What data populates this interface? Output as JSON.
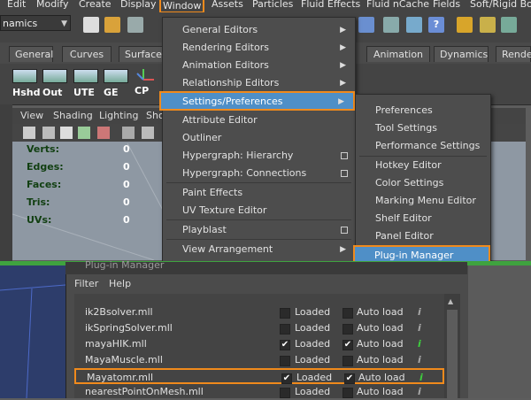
{
  "menubar": {
    "items": [
      "Edit",
      "Modify",
      "Create",
      "Display",
      "Window",
      "Assets",
      "Particles",
      "Fluid Effects",
      "Fluid nCache",
      "Fields",
      "Soft/Rigid Bod"
    ]
  },
  "toolbar": {
    "mode_combo": "namics"
  },
  "shelf": {
    "tabs": [
      "General",
      "Curves",
      "Surfaces",
      "Animation",
      "Dynamics",
      "Rende"
    ],
    "buttons": [
      "Hshd",
      "Out",
      "UTE",
      "GE",
      "CP"
    ]
  },
  "viewport": {
    "menu": [
      "View",
      "Shading",
      "Lighting",
      "Sho"
    ],
    "stats": [
      {
        "label": "Verts:",
        "value": "0"
      },
      {
        "label": "Edges:",
        "value": "0"
      },
      {
        "label": "Faces:",
        "value": "0"
      },
      {
        "label": "Tris:",
        "value": "0"
      },
      {
        "label": "UVs:",
        "value": "0"
      }
    ]
  },
  "window_menu": {
    "items": [
      {
        "label": "General Editors",
        "submenu": true
      },
      {
        "label": "Rendering Editors",
        "submenu": true
      },
      {
        "label": "Animation Editors",
        "submenu": true
      },
      {
        "label": "Relationship Editors",
        "submenu": true
      },
      {
        "label": "Settings/Preferences",
        "submenu": true
      },
      {
        "label": "Attribute Editor"
      },
      {
        "label": "Outliner"
      },
      {
        "label": "Hypergraph: Hierarchy",
        "option": true
      },
      {
        "label": "Hypergraph: Connections",
        "option": true
      },
      {
        "label": "Paint Effects"
      },
      {
        "label": "UV Texture Editor"
      },
      {
        "label": "Playblast",
        "option": true
      },
      {
        "label": "View Arrangement",
        "submenu": true
      }
    ]
  },
  "settings_submenu": {
    "items": [
      "Preferences",
      "Tool Settings",
      "Performance Settings",
      "Hotkey Editor",
      "Color Settings",
      "Marking Menu Editor",
      "Shelf Editor",
      "Panel Editor",
      "Plug-in Manager"
    ]
  },
  "plugin_manager": {
    "title": "Plug-in Manager",
    "menu": [
      "Filter",
      "Help"
    ],
    "loaded_label": "Loaded",
    "autoload_label": "Auto load",
    "info_symbol": "i",
    "plugins": [
      {
        "name": "ik2Bsolver.mll",
        "loaded": false,
        "autoload": false
      },
      {
        "name": "ikSpringSolver.mll",
        "loaded": false,
        "autoload": false
      },
      {
        "name": "mayaHIK.mll",
        "loaded": true,
        "autoload": true
      },
      {
        "name": "MayaMuscle.mll",
        "loaded": false,
        "autoload": false
      },
      {
        "name": "Mayatomr.mll",
        "loaded": true,
        "autoload": true
      },
      {
        "name": "nearestPointOnMesh.mll",
        "loaded": false,
        "autoload": false
      }
    ],
    "colors": {
      "info_active": "#3ecf3e",
      "info_inactive": "#a8a8a8"
    }
  },
  "colors": {
    "highlight_outline": "#f08a1c",
    "menu_selection": "#4f8fc7",
    "divider": "#3fa33f"
  }
}
